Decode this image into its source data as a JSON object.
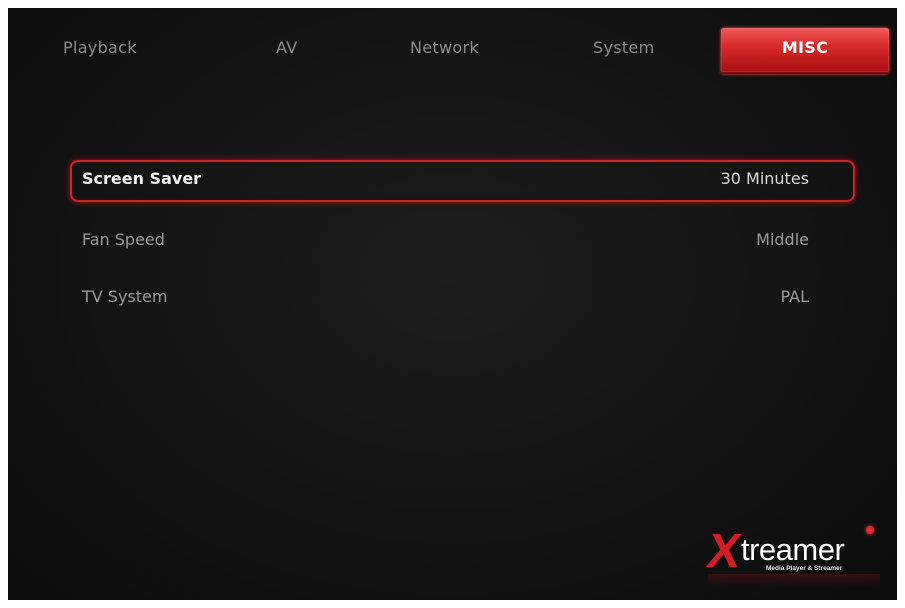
{
  "tabs": [
    {
      "label": "Playback",
      "active": false
    },
    {
      "label": "AV",
      "active": false
    },
    {
      "label": "Network",
      "active": false
    },
    {
      "label": "System",
      "active": false
    },
    {
      "label": "MISC",
      "active": true
    }
  ],
  "settings": [
    {
      "label": "Screen Saver",
      "value": "30 Minutes",
      "selected": true
    },
    {
      "label": "Fan Speed",
      "value": "Middle",
      "selected": false
    },
    {
      "label": "TV System",
      "value": "PAL",
      "selected": false
    }
  ],
  "logo": {
    "brand_letter": "X",
    "brand_rest": "treamer",
    "tagline": "Media Player & Streamer"
  },
  "colors": {
    "accent": "#d92a2a",
    "background": "#141414",
    "text_dim": "#9a9a9a",
    "text_bright": "#f2f2f2"
  }
}
